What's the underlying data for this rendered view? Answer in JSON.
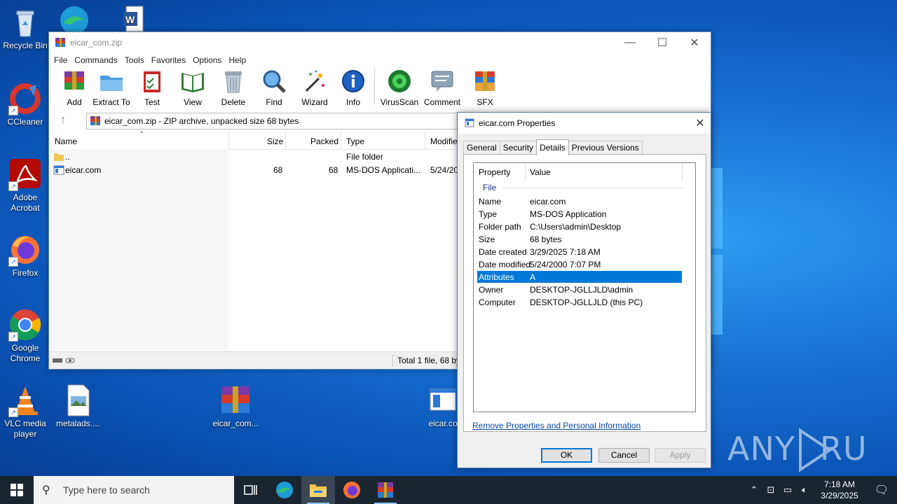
{
  "desktop": {
    "icons": [
      {
        "label": "Recycle Bin"
      },
      {
        "label": "CCleaner"
      },
      {
        "label": "Adobe Acrobat"
      },
      {
        "label": "Firefox"
      },
      {
        "label": "Google Chrome"
      },
      {
        "label": "VLC media player"
      },
      {
        "label": "metalads...."
      },
      {
        "label": "eicar_com..."
      },
      {
        "label": "eicar.co"
      }
    ],
    "watermark": "ANY RUN"
  },
  "winrar": {
    "title": "eicar_com.zip",
    "menu": [
      "File",
      "Commands",
      "Tools",
      "Favorites",
      "Options",
      "Help"
    ],
    "toolbar": [
      "Add",
      "Extract To",
      "Test",
      "View",
      "Delete",
      "Find",
      "Wizard",
      "Info",
      "VirusScan",
      "Comment",
      "SFX"
    ],
    "path": "eicar_com.zip - ZIP archive, unpacked size 68 bytes",
    "columns": {
      "name": "Name",
      "size": "Size",
      "packed": "Packed",
      "type": "Type",
      "modified": "Modifie"
    },
    "rows": [
      {
        "name": "..",
        "size": "",
        "packed": "",
        "type": "File folder",
        "modified": ""
      },
      {
        "name": "eicar.com",
        "size": "68",
        "packed": "68",
        "type": "MS-DOS Applicati...",
        "modified": "5/24/20"
      }
    ],
    "status_total": "Total 1 file, 68 by"
  },
  "properties": {
    "title": "eicar.com Properties",
    "tabs": [
      "General",
      "Security",
      "Details",
      "Previous Versions"
    ],
    "active_tab": "Details",
    "header": {
      "property": "Property",
      "value": "Value"
    },
    "group": "File",
    "rows": [
      {
        "property": "Name",
        "value": "eicar.com"
      },
      {
        "property": "Type",
        "value": "MS-DOS Application"
      },
      {
        "property": "Folder path",
        "value": "C:\\Users\\admin\\Desktop"
      },
      {
        "property": "Size",
        "value": "68 bytes"
      },
      {
        "property": "Date created",
        "value": "3/29/2025 7:18 AM"
      },
      {
        "property": "Date modified",
        "value": "5/24/2000 7:07 PM"
      },
      {
        "property": "Attributes",
        "value": "A"
      },
      {
        "property": "Owner",
        "value": "DESKTOP-JGLLJLD\\admin"
      },
      {
        "property": "Computer",
        "value": "DESKTOP-JGLLJLD (this PC)"
      }
    ],
    "selected_row": "Attributes",
    "remove_link": "Remove Properties and Personal Information",
    "buttons": {
      "ok": "OK",
      "cancel": "Cancel",
      "apply": "Apply"
    }
  },
  "taskbar": {
    "search_placeholder": "Type here to search",
    "time": "7:18 AM",
    "date": "3/29/2025"
  }
}
